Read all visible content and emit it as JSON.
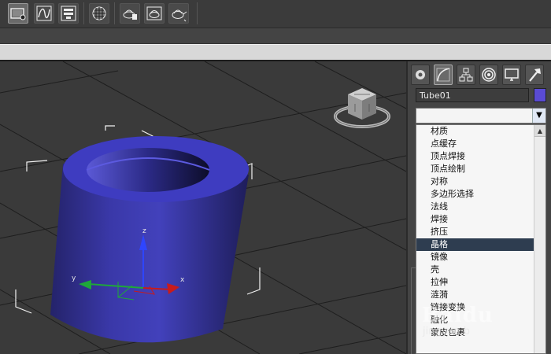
{
  "toolbar": {
    "buttons": [
      {
        "name": "scene-explorer-icon",
        "selected": true
      },
      {
        "name": "curve-editor-icon"
      },
      {
        "name": "schematic-view-icon"
      },
      {
        "name": "material-editor-icon"
      },
      {
        "name": "render-setup-icon"
      },
      {
        "name": "rendered-frame-icon"
      },
      {
        "name": "render-teapot-icon"
      }
    ]
  },
  "command_panel": {
    "tabs": [
      {
        "name": "create-tab-icon"
      },
      {
        "name": "modify-tab-icon",
        "selected": true
      },
      {
        "name": "hierarchy-tab-icon"
      },
      {
        "name": "motion-tab-icon"
      },
      {
        "name": "display-tab-icon"
      },
      {
        "name": "utilities-tab-icon"
      }
    ],
    "object_name": "Tube01",
    "object_color": "#5a4bd4",
    "modifier_list_value": "",
    "modifier_list": {
      "items": [
        "材质",
        "点缓存",
        "顶点焊接",
        "顶点绘制",
        "对称",
        "多边形选择",
        "法线",
        "焊接",
        "挤压",
        "晶格",
        "镜像",
        "壳",
        "拉伸",
        "涟漪",
        "链接变换",
        "融化",
        "蒙皮包裹"
      ],
      "selected": "晶格"
    }
  },
  "viewport": {
    "axis_labels": {
      "x": "x",
      "y": "y",
      "z": "z"
    },
    "object_color": "#3f3ab8"
  },
  "watermark": {
    "brand": "Baidu",
    "sub": "jingyan.b"
  }
}
